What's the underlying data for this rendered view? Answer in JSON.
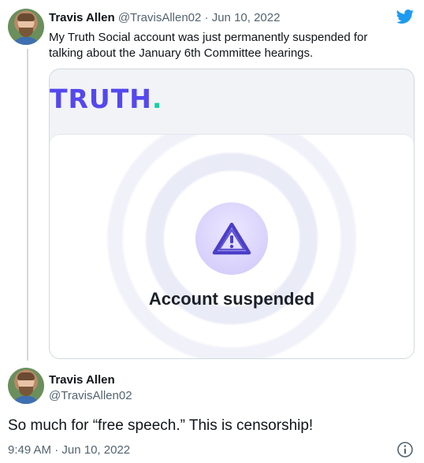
{
  "tweet1": {
    "name": "Travis Allen",
    "handle": "@TravisAllen02",
    "separator": "·",
    "date": "Jun 10, 2022",
    "text": "My Truth Social account was just permanently suspended for talking about the January 6th Committee hearings."
  },
  "card": {
    "logo_text": "TRUTH",
    "logo_dot": ".",
    "message": "Account suspended",
    "icon": "warning-triangle-icon",
    "colors": {
      "logo": "#5448ee",
      "logo_dot": "#17d0a4",
      "icon": "#4b3fc9"
    }
  },
  "tweet2": {
    "name": "Travis Allen",
    "handle": "@TravisAllen02",
    "text": "So much for “free speech.” This is censorship!",
    "time": "9:49 AM",
    "separator": "·",
    "date": "Jun 10, 2022"
  },
  "icons": {
    "brand": "twitter-bird-icon",
    "info": "info-icon"
  },
  "colors": {
    "twitter_blue": "#1d9bf0",
    "muted": "#536471"
  }
}
